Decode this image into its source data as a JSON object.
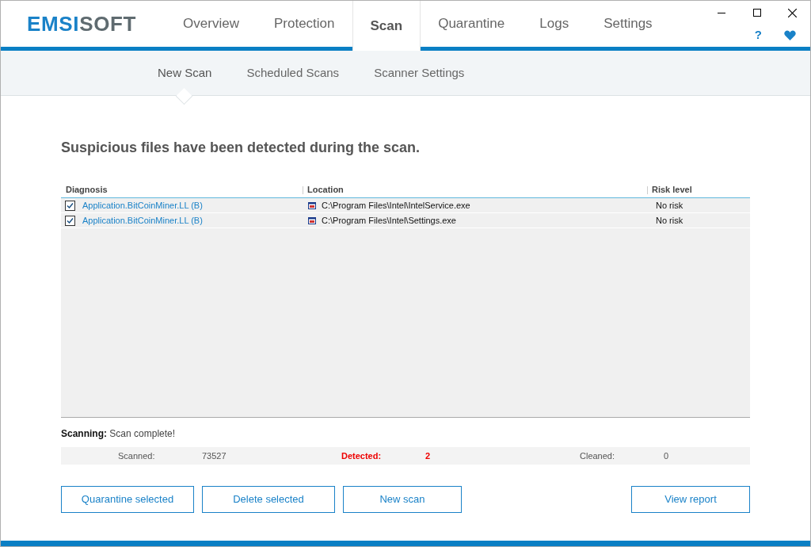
{
  "logo": {
    "accent": "EMSI",
    "rest": "SOFT"
  },
  "tabs": [
    {
      "label": "Overview",
      "selected": false
    },
    {
      "label": "Protection",
      "selected": false
    },
    {
      "label": "Scan",
      "selected": true
    },
    {
      "label": "Quarantine",
      "selected": false
    },
    {
      "label": "Logs",
      "selected": false
    },
    {
      "label": "Settings",
      "selected": false
    }
  ],
  "help_label": "?",
  "subtabs": [
    {
      "label": "New Scan",
      "selected": true
    },
    {
      "label": "Scheduled Scans",
      "selected": false
    },
    {
      "label": "Scanner Settings",
      "selected": false
    }
  ],
  "heading": "Suspicious files have been detected during the scan.",
  "table": {
    "columns": [
      "Diagnosis",
      "Location",
      "Risk level"
    ],
    "rows": [
      {
        "checked": true,
        "diagnosis": "Application.BitCoinMiner.LL (B)",
        "location": "C:\\Program Files\\Intel\\IntelService.exe",
        "risk": "No risk"
      },
      {
        "checked": true,
        "diagnosis": "Application.BitCoinMiner.LL (B)",
        "location": "C:\\Program Files\\Intel\\Settings.exe",
        "risk": "No risk"
      }
    ]
  },
  "status": {
    "label": "Scanning:",
    "value": "Scan complete!"
  },
  "stats": [
    {
      "label": "Scanned:",
      "value": "73527",
      "alert": false
    },
    {
      "label": "Detected:",
      "value": "2",
      "alert": true
    },
    {
      "label": "Cleaned:",
      "value": "0",
      "alert": false
    }
  ],
  "buttons": [
    "Quarantine selected",
    "Delete selected",
    "New scan"
  ],
  "report_button": "View report"
}
